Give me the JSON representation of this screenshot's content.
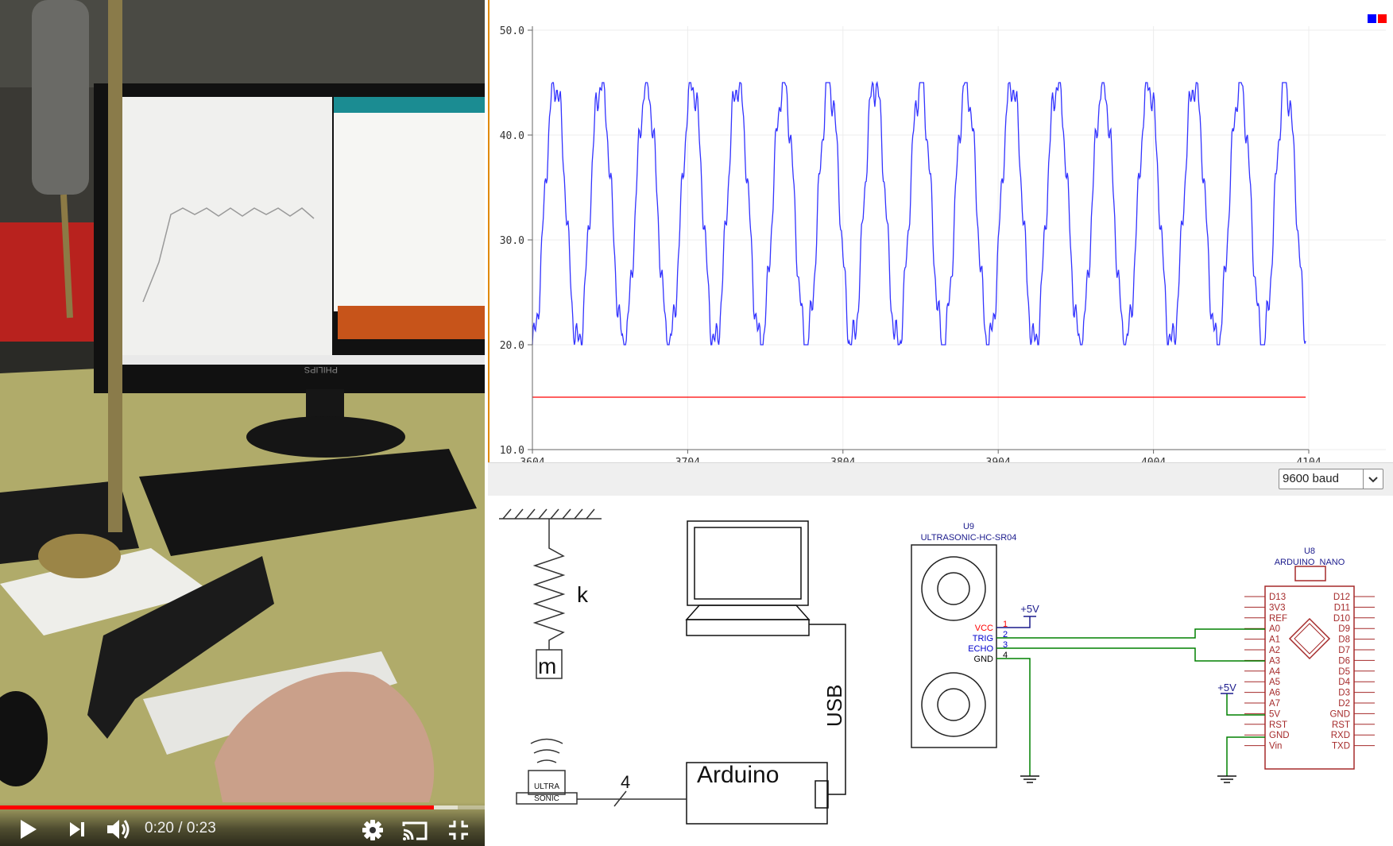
{
  "video_player": {
    "current_time": "0:20",
    "separator": " / ",
    "duration": "0:23",
    "progress_fraction": 0.895,
    "buffered_fraction": 0.945,
    "monitor_brand": "PHILIPS",
    "icons": [
      "play-icon",
      "next-icon",
      "volume-icon",
      "settings-icon",
      "cast-icon",
      "exit-fullscreen-icon"
    ],
    "colors": {
      "progress": "#ff0000"
    }
  },
  "serial_plotter": {
    "baud_selected": "9600 baud",
    "legend_swatches": [
      "#0000ff",
      "#ff0000"
    ],
    "icons": [
      "chevron-down-icon"
    ]
  },
  "chart_data": {
    "type": "line",
    "title": "",
    "xlabel": "",
    "ylabel": "",
    "xlim": [
      3604,
      4104
    ],
    "ylim": [
      10,
      50
    ],
    "x_ticks": [
      "3604",
      "3704",
      "3804",
      "3904",
      "4004",
      "4104"
    ],
    "y_ticks": [
      "10.0",
      "20.0",
      "30.0",
      "40.0",
      "50.0"
    ],
    "grid": true,
    "legend": "top-right",
    "series": [
      {
        "color": "#3333ff",
        "kind": "oscillation",
        "min": 20.0,
        "max": 45.0,
        "period": 29.4,
        "start_x": 3604,
        "end_x": 4102
      },
      {
        "color": "#ff0000",
        "kind": "constant",
        "value": 15.0,
        "start_x": 3604,
        "end_x": 4102
      }
    ]
  },
  "diagram": {
    "spring_label": "k",
    "mass_label": "m",
    "usb_label": "USB",
    "arduino_label": "Arduino",
    "sensor_label_line1": "ULTRA",
    "sensor_label_line2": "SONIC",
    "bus_width_label": "4"
  },
  "schematic": {
    "u9": {
      "ref": "U9",
      "name": "ULTRASONIC-HC-SR04",
      "supply": "+5V",
      "pins": [
        {
          "label": "VCC",
          "num": "1",
          "color": "#ff0000"
        },
        {
          "label": "TRIG",
          "num": "2",
          "color": "#0000cc"
        },
        {
          "label": "ECHO",
          "num": "3",
          "color": "#0000cc"
        },
        {
          "label": "GND",
          "num": "4",
          "color": "#000000"
        }
      ]
    },
    "u8": {
      "ref": "U8",
      "name": "ARDUINO_NANO",
      "supply": "+5V",
      "left_pins": [
        "D13",
        "3V3",
        "REF",
        "A0",
        "A1",
        "A2",
        "A3",
        "A4",
        "A5",
        "A6",
        "A7",
        "5V",
        "RST",
        "GND",
        "Vin"
      ],
      "right_pins": [
        "D12",
        "D11",
        "D10",
        "D9",
        "D8",
        "D7",
        "D6",
        "D5",
        "D4",
        "D3",
        "D2",
        "GND",
        "RST",
        "RXD",
        "TXD"
      ]
    },
    "colors": {
      "label": "#1a1a8c",
      "part": "#a52a2a",
      "wire": "#008000"
    }
  }
}
